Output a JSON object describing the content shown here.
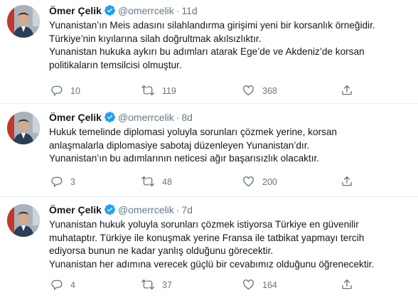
{
  "colors": {
    "verified": "#1da1f2",
    "secondary_text": "#657786",
    "text": "#14171a",
    "divider": "#e6ecf0"
  },
  "tweets": [
    {
      "name": "Ömer Çelik",
      "handle": "@omerrcelik",
      "separator": "·",
      "time": "11d",
      "lines": [
        "Yunanistan’ın Meis adasını silahlandırma girişimi yeni bir korsanlık örneğidir.",
        "Türkiye’nin kıyılarına silah doğrultmak akılsızlıktır.",
        "Yunanistan hukuka aykırı bu adımları atarak Ege’de ve Akdeniz’de korsan",
        "politikaların temsilcisi olmuştur."
      ],
      "replies": "10",
      "retweets": "119",
      "likes": "368",
      "icons": {
        "reply": "reply-icon",
        "retweet": "retweet-icon",
        "like": "heart-icon",
        "share": "share-icon"
      }
    },
    {
      "name": "Ömer Çelik",
      "handle": "@omerrcelik",
      "separator": "·",
      "time": "8d",
      "lines": [
        "Hukuk temelinde diplomasi yoluyla sorunları çözmek yerine, korsan",
        "anlaşmalarla diplomasiye sabotaj düzenleyen Yunanistan’dır.",
        "Yunanistan’ın bu adımlarının neticesi  ağır başarısızlık olacaktır."
      ],
      "replies": "3",
      "retweets": "48",
      "likes": "200",
      "icons": {
        "reply": "reply-icon",
        "retweet": "retweet-icon",
        "like": "heart-icon",
        "share": "share-icon"
      }
    },
    {
      "name": "Ömer Çelik",
      "handle": "@omerrcelik",
      "separator": "·",
      "time": "7d",
      "lines": [
        "Yunanistan hukuk yoluyla sorunları çözmek istiyorsa Türkiye en güvenilir",
        "muhataptır. Türkiye ile konuşmak  yerine Fransa ile tatbikat yapmayı tercih",
        "ediyorsa bunun ne kadar yanlış olduğunu görecektir.",
        "Yunanistan her adımına verecek güçlü bir cevabımız olduğunu öğrenecektir."
      ],
      "replies": "4",
      "retweets": "37",
      "likes": "164",
      "icons": {
        "reply": "reply-icon",
        "retweet": "retweet-icon",
        "like": "heart-icon",
        "share": "share-icon"
      }
    }
  ]
}
